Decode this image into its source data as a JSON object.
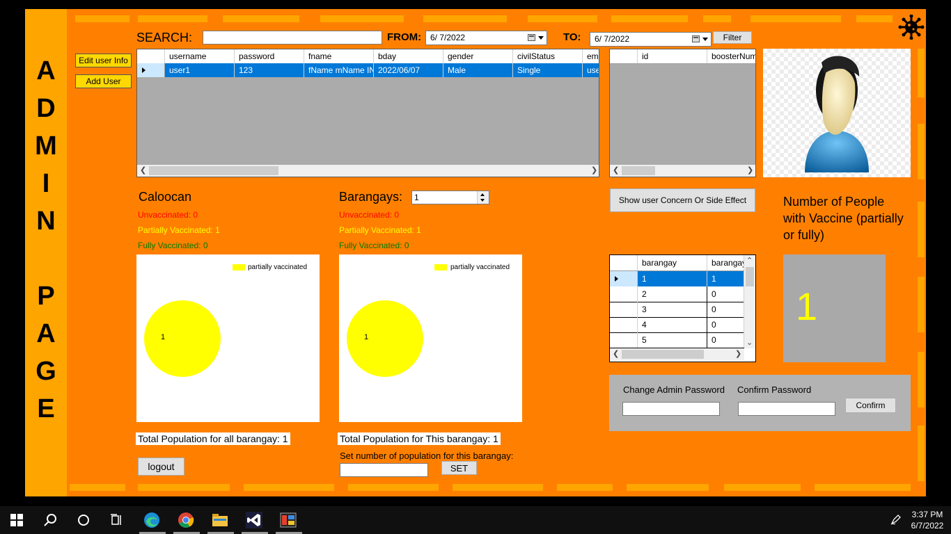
{
  "sidebar": {
    "title_word1": [
      "A",
      "D",
      "M",
      "I",
      "N"
    ],
    "title_word2": [
      "P",
      "A",
      "G",
      "E"
    ]
  },
  "search": {
    "label": "SEARCH:",
    "value": "",
    "from_label": "FROM:",
    "from_date": "6/  7/2022",
    "to_label": "TO:",
    "to_date": "6/  7/2022",
    "filter_label": "Filter"
  },
  "actions": {
    "edit_user": "Edit user Info",
    "add_user": "Add User"
  },
  "users_grid": {
    "columns": [
      "username",
      "password",
      "fname",
      "bday",
      "gender",
      "civilStatus",
      "ema"
    ],
    "rows": [
      [
        "user1",
        "123",
        "fName mName IN...",
        "2022/06/07",
        "Male",
        "Single",
        "user"
      ]
    ]
  },
  "booster_grid": {
    "columns": [
      "id",
      "boosterNum"
    ]
  },
  "city": {
    "name": "Caloocan",
    "unvaccinated": "Unvaccinated: 0",
    "partially": "Partially Vaccinated: 1",
    "fully": "Fully Vaccinated: 0",
    "total": "Total Population for all barangay: 1"
  },
  "barangay": {
    "label": "Barangays:",
    "selected": "1",
    "unvaccinated": "Unvaccinated: 0",
    "partially": "Partially Vaccinated: 1",
    "fully": "Fully Vaccinated: 0",
    "total": "Total Population for This barangay: 1",
    "set_label": "Set number of population for this barangay:",
    "set_value": "",
    "set_button": "SET"
  },
  "chart_data": [
    {
      "type": "pie",
      "categories": [
        "partially vaccinated"
      ],
      "values": [
        1
      ],
      "data_labels": [
        "1"
      ],
      "legend": "top-right",
      "colors": [
        "#ffff00"
      ]
    },
    {
      "type": "pie",
      "categories": [
        "partially vaccinated"
      ],
      "values": [
        1
      ],
      "data_labels": [
        "1"
      ],
      "legend": "top-right",
      "colors": [
        "#ffff00"
      ]
    }
  ],
  "concern_button": "Show user Concern Or Side Effect",
  "barangay_grid": {
    "columns": [
      "barangay",
      "barangay"
    ],
    "rows": [
      [
        "1",
        "1"
      ],
      [
        "2",
        "0"
      ],
      [
        "3",
        "0"
      ],
      [
        "4",
        "0"
      ],
      [
        "5",
        "0"
      ]
    ]
  },
  "vaccine_panel": {
    "title": "Number of People with Vaccine (partially or fully)",
    "count": "1"
  },
  "password_panel": {
    "change_label": "Change Admin Password",
    "confirm_label": "Confirm Password",
    "change_value": "",
    "confirm_value": "",
    "confirm_button": "Confirm"
  },
  "logout_label": "logout",
  "taskbar": {
    "time": "3:37 PM",
    "date": "6/7/2022",
    "apps": [
      "start-icon",
      "search-icon",
      "cortana-icon",
      "task-view-icon",
      "edge-icon",
      "chrome-icon",
      "file-explorer-icon",
      "visual-studio-icon",
      "winforms-app-icon"
    ]
  },
  "colors": {
    "background": "#ff8000",
    "sidebar": "#ffa500",
    "selected_row": "#0078d7",
    "unvaccinated": "#ff0000",
    "partially": "#ffff00",
    "fully": "#008000"
  }
}
